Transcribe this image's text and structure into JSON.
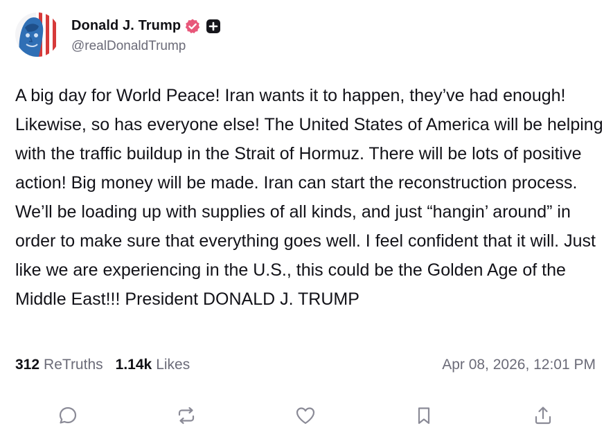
{
  "author": {
    "display_name": "Donald J. Trump",
    "handle": "@realDonaldTrump",
    "verified_badge_icon": "verified-badge-icon",
    "plus_badge_icon": "plus-badge-icon",
    "verified_color": "#e8577a"
  },
  "post": {
    "text": "A big day for World Peace! Iran wants it to happen, they’ve had enough! Likewise, so has everyone else! The United States of America will be helping with the traffic buildup in the Strait of Hormuz. There will be lots of positive action! Big money will be made. Iran can start the reconstruction process. We’ll be loading up with supplies of all kinds, and just “hangin’ around” in order to make sure that everything goes well. I feel confident that it will. Just like we are experiencing in the U.S., this could be the Golden Age of the Middle East!!! President DONALD J. TRUMP"
  },
  "stats": {
    "retruths_count": "312",
    "retruths_label": "ReTruths",
    "likes_count": "1.14k",
    "likes_label": "Likes",
    "timestamp": "Apr 08, 2026, 12:01 PM"
  },
  "actions": [
    {
      "name": "reply",
      "icon": "comment-icon"
    },
    {
      "name": "retruth",
      "icon": "repost-icon"
    },
    {
      "name": "like",
      "icon": "heart-icon"
    },
    {
      "name": "bookmark",
      "icon": "bookmark-icon"
    },
    {
      "name": "share",
      "icon": "share-icon"
    }
  ],
  "colors": {
    "text": "#121218",
    "muted": "#6b6b78",
    "icon": "#8a8a96"
  }
}
